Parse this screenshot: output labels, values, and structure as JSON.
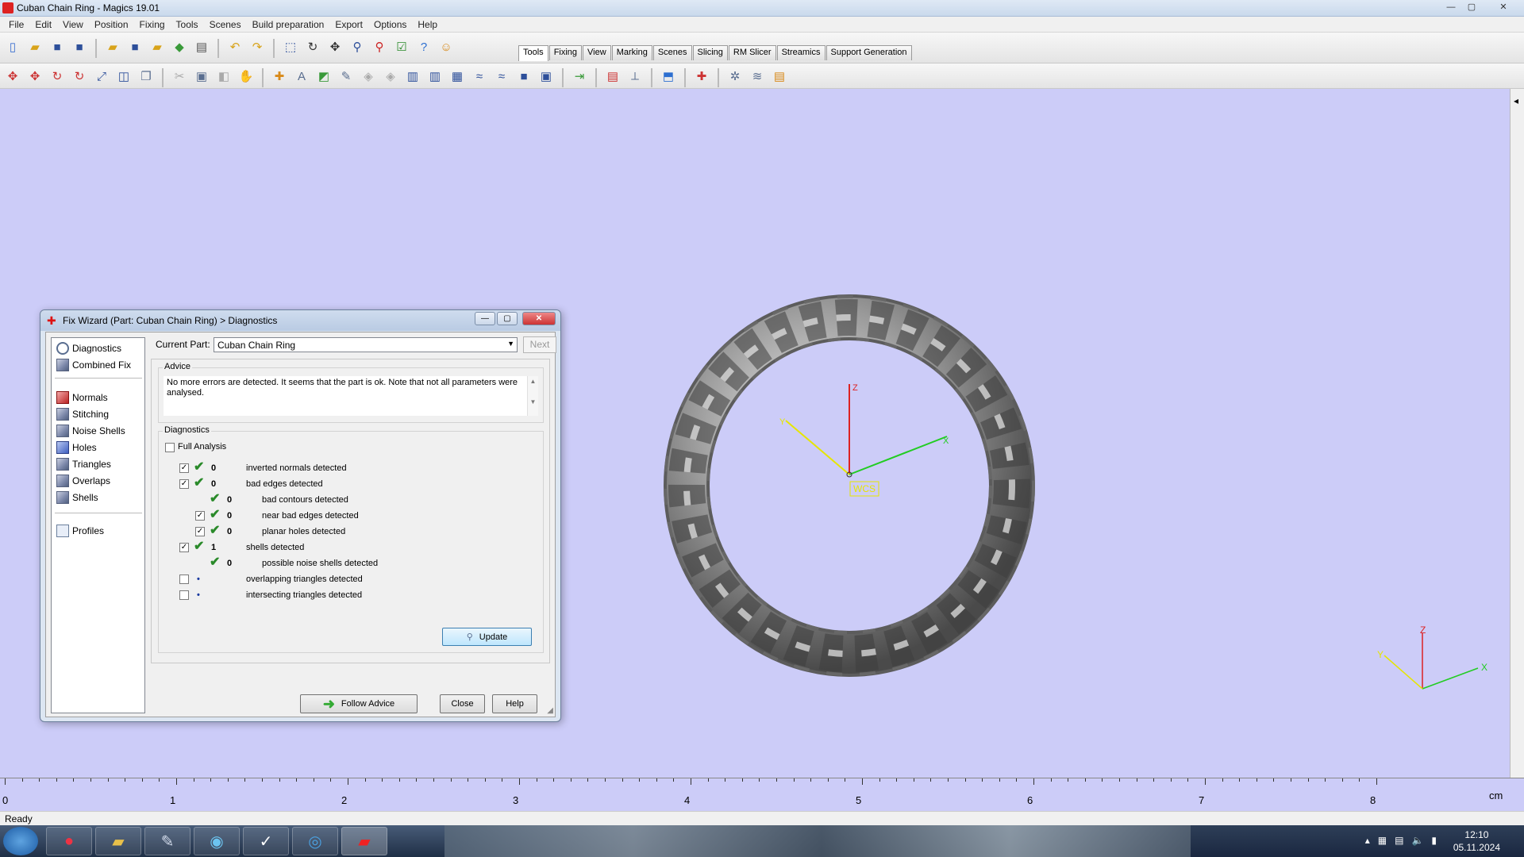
{
  "window": {
    "title": "Cuban Chain Ring - Magics 19.01",
    "min": "—",
    "max": "▢",
    "close": "✕"
  },
  "menu": [
    "File",
    "Edit",
    "View",
    "Position",
    "Fixing",
    "Tools",
    "Scenes",
    "Build preparation",
    "Export",
    "Options",
    "Help"
  ],
  "tabs": [
    "Tools",
    "Fixing",
    "View",
    "Marking",
    "Scenes",
    "Slicing",
    "RM Slicer",
    "Streamics",
    "Support Generation"
  ],
  "active_tab": "Tools",
  "viewport": {
    "axis_x": "X",
    "axis_y": "Y",
    "axis_z": "Z",
    "wcs_label": "WCS",
    "mini_x": "X",
    "mini_y": "Y",
    "mini_z": "Z"
  },
  "ruler": {
    "labels": [
      "0",
      "1",
      "2",
      "3",
      "4",
      "5",
      "6",
      "7",
      "8"
    ],
    "unit": "cm"
  },
  "status": "Ready",
  "taskbar": {
    "time": "12:10",
    "date": "05.11.2024"
  },
  "dialog": {
    "title": "Fix Wizard (Part: Cuban Chain Ring) > Diagnostics",
    "nav_top": [
      {
        "label": "Diagnostics",
        "icon": "magnifier-icon"
      },
      {
        "label": "Combined Fix",
        "icon": "cube-icon"
      }
    ],
    "nav_items": [
      {
        "label": "Normals",
        "icon": "normals-icon"
      },
      {
        "label": "Stitching",
        "icon": "stitching-icon"
      },
      {
        "label": "Noise Shells",
        "icon": "noise-shells-icon"
      },
      {
        "label": "Holes",
        "icon": "holes-icon"
      },
      {
        "label": "Triangles",
        "icon": "triangles-icon"
      },
      {
        "label": "Overlaps",
        "icon": "overlaps-icon"
      },
      {
        "label": "Shells",
        "icon": "shells-icon"
      }
    ],
    "profiles_label": "Profiles",
    "current_part_label": "Current Part:",
    "current_part_value": "Cuban Chain Ring",
    "next_label": "Next",
    "advice_title": "Advice",
    "advice_text": "No more errors are detected. It seems that the part is ok. Note that not all parameters were analysed.",
    "diagnostics_title": "Diagnostics",
    "full_analysis_label": "Full Analysis",
    "rows": [
      {
        "count": "0",
        "label": "inverted normals detected"
      },
      {
        "count": "0",
        "label": "bad edges detected"
      },
      {
        "count": "0",
        "label": "bad contours detected"
      },
      {
        "count": "0",
        "label": "near bad edges detected"
      },
      {
        "count": "0",
        "label": "planar holes detected"
      },
      {
        "count": "1",
        "label": "shells detected"
      },
      {
        "count": "0",
        "label": "possible noise shells detected"
      },
      {
        "count": "•",
        "label": "overlapping triangles detected"
      },
      {
        "count": "•",
        "label": "intersecting triangles detected"
      }
    ],
    "update_label": "Update",
    "follow_label": "Follow Advice",
    "close_label": "Close",
    "help_label": "Help"
  },
  "colors": {
    "viewport_bg": "#ccccf8",
    "axis_x": "#22cc22",
    "axis_y": "#e6e600",
    "axis_z": "#dd2222"
  }
}
